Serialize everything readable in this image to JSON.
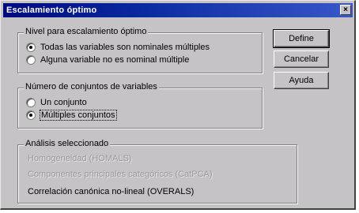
{
  "window": {
    "title": "Escalamiento óptimo",
    "close_glyph": "×"
  },
  "level_group": {
    "label": "Nivel para escalamiento óptimo",
    "options": [
      {
        "label": "Todas las variables son nominales múltiples",
        "selected": true
      },
      {
        "label": "Alguna variable no es nominal múltiple",
        "selected": false
      }
    ]
  },
  "sets_group": {
    "label": "Número de conjuntos de variables",
    "options": [
      {
        "label": "Un conjunto",
        "selected": false
      },
      {
        "label": "Múltiples conjuntos",
        "selected": true
      }
    ]
  },
  "analysis_group": {
    "label": "Análisis seleccionado",
    "items": [
      {
        "label": "Homogeneidad (HOMALS)",
        "enabled": false
      },
      {
        "label": "Componentes principales categóricos (CatPCA)",
        "enabled": false
      },
      {
        "label": "Correlación canónica no-lineal (OVERALS)",
        "enabled": true
      }
    ]
  },
  "buttons": {
    "define": "Define",
    "cancel": "Cancelar",
    "help": "Ayuda"
  }
}
